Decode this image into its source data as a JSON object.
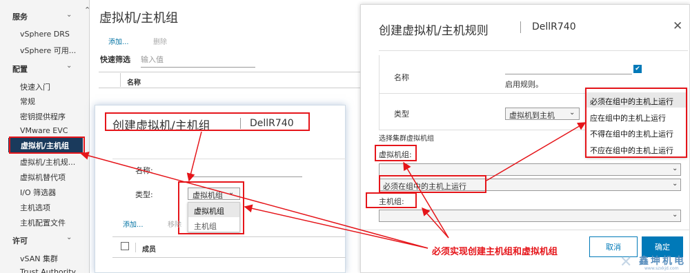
{
  "sidebar": {
    "services_header": "服务",
    "services_items": [
      "vSphere DRS",
      "vSphere 可用..."
    ],
    "config_header": "配置",
    "config_items": [
      "快速入门",
      "常规",
      "密钥提供程序",
      "VMware EVC"
    ],
    "active_item": "虚拟机/主机组",
    "config_items_after": [
      "虚拟机/主机规...",
      "虚拟机替代项",
      "I/O 筛选器",
      "主机选项",
      "主机配置文件"
    ],
    "license_header": "许可",
    "license_items": [
      "vSAN 集群",
      "Trust Authority"
    ]
  },
  "main": {
    "title": "虚拟机/主机组",
    "add": "添加...",
    "delete": "删除",
    "quick_filter": "快速筛选",
    "filter_placeholder": "输入值",
    "col_name": "名称"
  },
  "dialog_left": {
    "title": "创建虚拟机/主机组",
    "cluster": "DellR740",
    "name_label": "名称:",
    "type_label": "类型:",
    "type_value": "虚拟机组",
    "type_options": [
      "虚拟机组",
      "主机组"
    ],
    "add": "添加...",
    "remove": "移除",
    "member_col": "成员"
  },
  "dialog_right": {
    "title": "创建虚拟机/主机规则",
    "cluster": "DellR740",
    "name_label": "名称",
    "enable_label": "启用规则。",
    "type_label": "类型",
    "type_value": "虚拟机到主机",
    "cluster_vm_group": "选择集群虚拟机组",
    "vm_group_label": "虚拟机组:",
    "rule_value": "必须在组中的主机上运行",
    "host_group_label": "主机组:",
    "cancel": "取消",
    "ok": "确定",
    "rule_options": [
      "必须在组中的主机上运行",
      "应在组中的主机上运行",
      "不得在组中的主机上运行",
      "不应在组中的主机上运行"
    ]
  },
  "annotation": "必须实现创建主机组和虚拟机组",
  "watermark": {
    "name": "鑫坤机电",
    "url": "www.szxkjd.com"
  },
  "colors": {
    "red": "#e5151a",
    "link": "#0072a3",
    "nav_active": "#1a3a5c",
    "primary": "#0079b8"
  }
}
